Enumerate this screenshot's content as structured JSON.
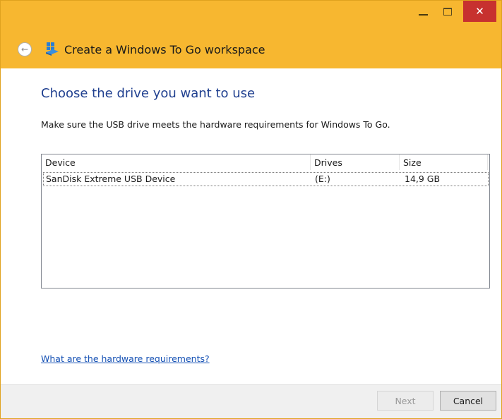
{
  "window": {
    "title": "Create a Windows To Go workspace",
    "accent_color": "#f7b730",
    "close_label": "✕"
  },
  "nav": {
    "back_icon": "back-arrow-icon",
    "app_icon": "windows-to-go-icon"
  },
  "main": {
    "heading": "Choose the drive you want to use",
    "description": "Make sure the USB drive meets the hardware requirements for Windows To Go.",
    "table": {
      "columns": [
        "Device",
        "Drives",
        "Size"
      ],
      "rows": [
        {
          "device": "SanDisk Extreme USB Device",
          "drives": "(E:)",
          "size": "14,9 GB"
        }
      ]
    },
    "help_link": "What are the hardware requirements?"
  },
  "footer": {
    "next_label": "Next",
    "cancel_label": "Cancel"
  }
}
